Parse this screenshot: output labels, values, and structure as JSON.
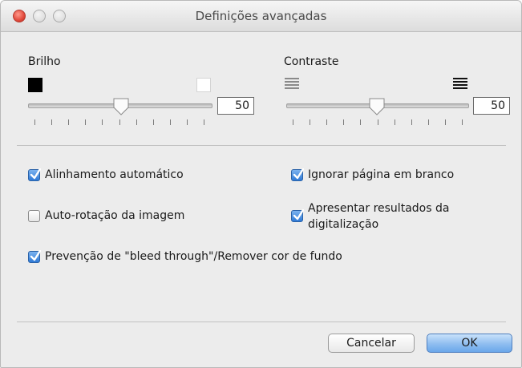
{
  "window": {
    "title": "Definições avançadas"
  },
  "brightness": {
    "label": "Brilho",
    "value": "50",
    "low_icon": "black-square-icon",
    "high_icon": "white-square-icon",
    "slider_level": 0.5
  },
  "contrast": {
    "label": "Contraste",
    "value": "50",
    "low_icon": "low-contrast-lines-icon",
    "high_icon": "high-contrast-lines-icon",
    "slider_level": 0.5
  },
  "options": {
    "auto_align": {
      "label": "Alinhamento automático",
      "checked": true
    },
    "ignore_blank": {
      "label": "Ignorar página em branco",
      "checked": true
    },
    "auto_rotate": {
      "label": "Auto-rotação da imagem",
      "checked": false
    },
    "show_results_line1": "Apresentar resultados da",
    "show_results_line2": "digitalização",
    "show_results_checked": true,
    "bleed_through": {
      "label": "Prevenção de \"bleed through\"/Remover cor de fundo",
      "checked": true
    }
  },
  "buttons": {
    "cancel": "Cancelar",
    "ok": "OK"
  },
  "colors": {
    "accent": "#2f7ad6",
    "ok_button": "#8fbdf0",
    "close_button": "#e2493c"
  }
}
